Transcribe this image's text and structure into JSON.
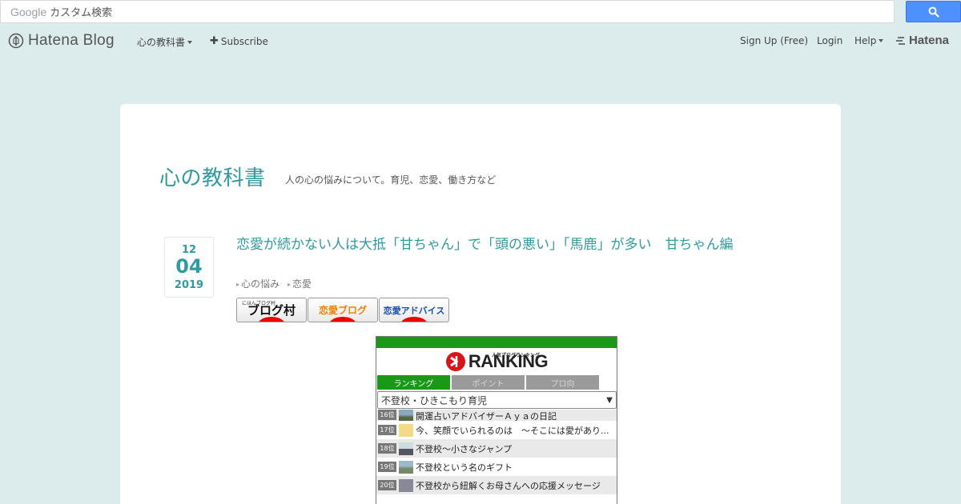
{
  "search": {
    "brand": "Google",
    "placeholder": "カスタム検索"
  },
  "header": {
    "brand": "Hatena Blog",
    "blog_menu": "心の教科書",
    "subscribe": "Subscribe",
    "signup": "Sign Up (Free)",
    "login": "Login",
    "help": "Help",
    "hatena": "Hatena"
  },
  "blog": {
    "title": "心の教科書",
    "description": "人の心の悩みについて。育児、恋愛、働き方など"
  },
  "entry": {
    "date": {
      "month": "12",
      "day": "04",
      "year": "2019"
    },
    "title": "恋愛が続かない人は大抵「甘ちゃん」で「頭の悪い」「馬鹿」が多い　甘ちゃん編",
    "categories": [
      "心の悩み",
      "恋愛"
    ],
    "banners": [
      {
        "small": "にほんブログ村",
        "text": "ブログ村"
      },
      {
        "text": "恋愛ブログ"
      },
      {
        "text": "恋愛アドバイス"
      }
    ]
  },
  "ranking": {
    "logo_sub": "人気ブログランキング",
    "logo": "RANKING",
    "tabs": [
      "ランキング",
      "ポイント",
      "プロ向"
    ],
    "selected": "不登校・ひきこもり育児",
    "rows": [
      {
        "pos": "16位",
        "title": "開運占いアドバイザーＡｙａの日記"
      },
      {
        "pos": "17位",
        "title": "今、笑顔でいられるのは　〜そこには愛があり..."
      },
      {
        "pos": "18位",
        "title": "不登校〜小さなジャンプ"
      },
      {
        "pos": "19位",
        "title": "不登校という名のギフト"
      },
      {
        "pos": "20位",
        "title": "不登校から紐解くお母さんへの応援メッセージ"
      }
    ]
  },
  "colors": {
    "accent": "#2f9aa0",
    "background": "#dcebeb",
    "rank_green": "#1a9918"
  }
}
